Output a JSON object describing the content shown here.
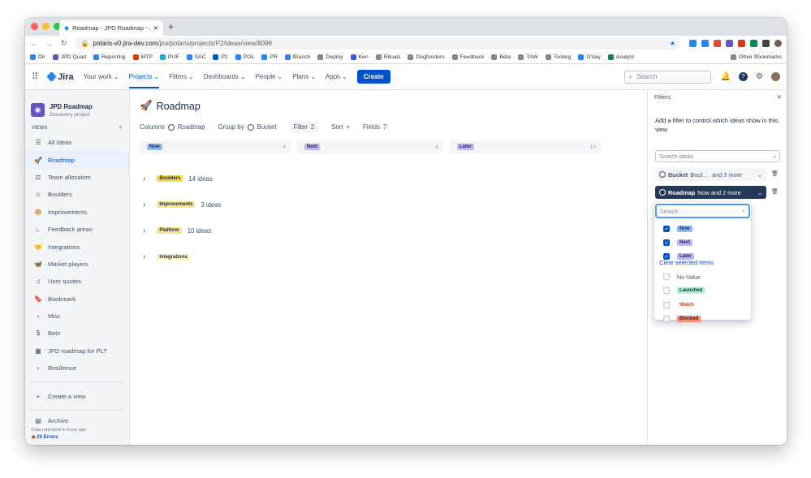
{
  "browser": {
    "tab_title": "Roadmap - JPD Roadmap - Jira",
    "url_host": "polaris-v0.jira-dev.com",
    "url_path": "/jira/polaris/projects/P2/ideas/view/8098",
    "bookmarks": [
      "Dir",
      "JPD Quad",
      "Reporting",
      "MTP",
      "PUF",
      "SAC",
      "P2",
      "POL",
      "PR",
      "Branch",
      "Deploy",
      "Ken",
      "Rituals",
      "Dogfooders",
      "Feedback",
      "Beta",
      "TAW",
      "Tooling",
      "G'day",
      "Analyst"
    ],
    "other_bookmarks": "Other Bookmarks"
  },
  "topnav": {
    "product": "Jira",
    "items": [
      "Your work",
      "Projects",
      "Filters",
      "Dashboards",
      "People",
      "Plans",
      "Apps"
    ],
    "create": "Create",
    "search_placeholder": "Search"
  },
  "sidebar": {
    "project_name": "JPD Roadmap",
    "project_type": "Discovery project",
    "views_heading": "VIEWS",
    "items": [
      {
        "label": "All Ideas",
        "icon": "list-icon"
      },
      {
        "label": "Roadmap",
        "icon": "rocket-icon"
      },
      {
        "label": "Team allocation",
        "icon": "scales-icon"
      },
      {
        "label": "Boulders",
        "icon": "face-icon"
      },
      {
        "label": "Improvements",
        "icon": "monkey-icon"
      },
      {
        "label": "Feedback areas",
        "icon": "chart-icon"
      },
      {
        "label": "Integrations",
        "icon": "handshake-icon"
      },
      {
        "label": "Market players",
        "icon": "butterfly-icon"
      },
      {
        "label": "User quotes",
        "icon": "music-icon"
      },
      {
        "label": "Bookmark",
        "icon": "bookmark-icon"
      },
      {
        "label": "Misc",
        "icon": "chevron-right-icon"
      },
      {
        "label": "Bets",
        "icon": "dollar-icon"
      },
      {
        "label": "JPD roadmap for PLT",
        "icon": "board-icon"
      },
      {
        "label": "Resilience",
        "icon": "chevron-right-icon"
      }
    ],
    "create_view": "Create a view",
    "archive": "Archive",
    "refreshed": "Data refreshed 4 hours ago",
    "errors": "20 Errors"
  },
  "content": {
    "title": "Roadmap",
    "toolbar": {
      "columns_label": "Columns",
      "columns_value": "Roadmap",
      "group_label": "Group by",
      "group_value": "Bucket",
      "filter_label": "Filter",
      "filter_count": "2",
      "sort_label": "Sort",
      "fields_label": "Fields",
      "fields_count": "7"
    },
    "columns": [
      {
        "name": "Now",
        "count": "9",
        "color": "#8fb8f6"
      },
      {
        "name": "Next",
        "count": "8",
        "color": "#c0b6f2"
      },
      {
        "name": "Later",
        "count": "10",
        "color": "#c0b6f2"
      }
    ],
    "groups": [
      {
        "name": "Boulders",
        "count": "14 ideas",
        "color": "#f8d94f"
      },
      {
        "name": "Improvements",
        "count": "3 ideas",
        "color": "#f8e48a"
      },
      {
        "name": "Platform",
        "count": "10 ideas",
        "color": "#f8e48a"
      },
      {
        "name": "Integrations",
        "count": "",
        "color": "#fff3c4"
      }
    ]
  },
  "filters_panel": {
    "title": "Filters",
    "description": "Add a filter to control which ideas show in this view",
    "search_placeholder": "Search ideas",
    "filter1": {
      "field": "Bucket",
      "value": "Boul...",
      "more": "and 3 more"
    },
    "filter2": {
      "field": "Roadmap",
      "value": "Now and 2 more"
    },
    "dropdown": {
      "search_placeholder": "Search",
      "options": [
        {
          "label": "Now",
          "checked": true,
          "color": "#8fb8f6"
        },
        {
          "label": "Next",
          "checked": true,
          "color": "#c0b6f2"
        },
        {
          "label": "Later",
          "checked": true,
          "color": "#c0b6f2"
        }
      ],
      "clear_label": "Clear selected items",
      "unchecked": [
        {
          "label": "No Value",
          "color": ""
        },
        {
          "label": "Launched",
          "color": "#abf5d1"
        },
        {
          "label": "Watch",
          "color": "#ffffff"
        },
        {
          "label": "Blocked",
          "color": "#ff8f73"
        }
      ]
    }
  }
}
